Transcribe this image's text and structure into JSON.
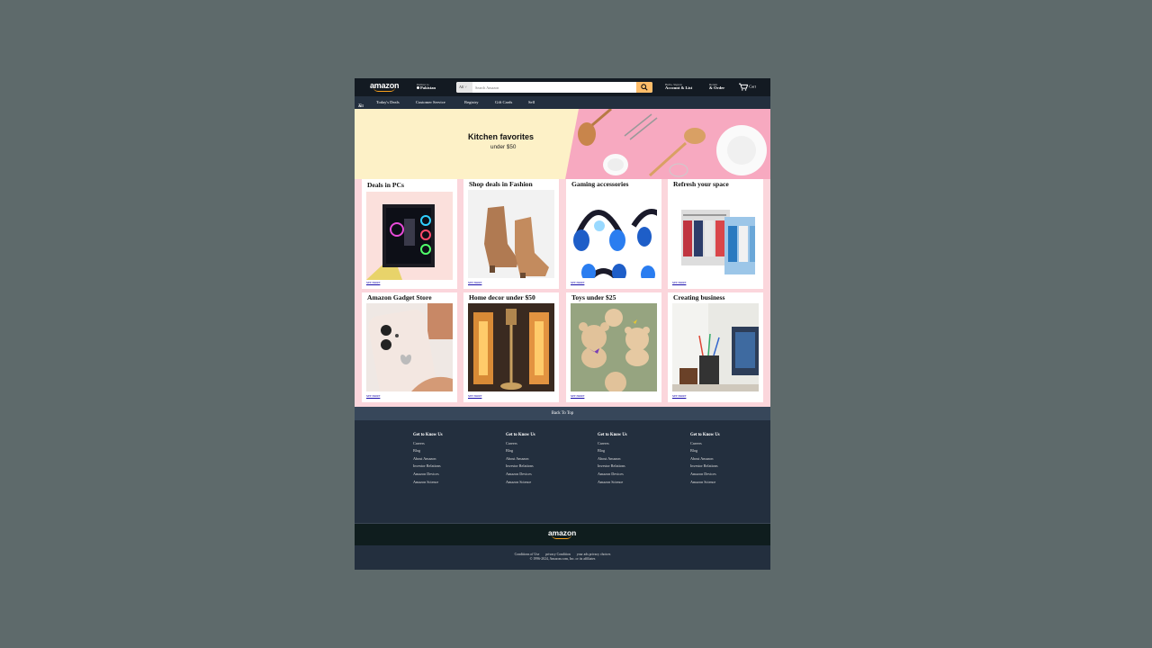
{
  "header": {
    "logo": "amazon",
    "deliver_line1": "Deliver to",
    "deliver_line2": "Pakistan",
    "search_category": "All",
    "search_placeholder": "Search Amazon",
    "account_line1": "Hello, Sign in",
    "account_line2": "Account & List",
    "returns_line1": "Return",
    "returns_line2": "& Order",
    "cart_label": "Cart"
  },
  "subnav": {
    "all_label": "All",
    "items": [
      "Today's Deals",
      "Customer Service",
      "Registry",
      "Gift Cards",
      "Sell"
    ]
  },
  "hero": {
    "title": "Kitchen favorites",
    "subtitle": "under $50"
  },
  "cards": [
    {
      "title": "Deals in PCs",
      "link": "see more"
    },
    {
      "title": "Shop deals in Fashion",
      "link": "see more"
    },
    {
      "title": "Gaming accessories",
      "link": "see more"
    },
    {
      "title": "Refresh your space",
      "link": "see more"
    },
    {
      "title": "Amazon Gadget Store",
      "link": "see more"
    },
    {
      "title": "Home decor under $50",
      "link": "see more"
    },
    {
      "title": "Toys under $25",
      "link": "see more"
    },
    {
      "title": "Creating business",
      "link": "see more"
    }
  ],
  "back_to_top": "Back To Top",
  "footer": {
    "columns": [
      {
        "heading": "Get to Know Us",
        "links": [
          "Careers",
          "Blog",
          "About Amazon",
          "Investor Relations",
          "Amazon Devices",
          "Amazon Science"
        ]
      },
      {
        "heading": "Get to Know Us",
        "links": [
          "Careers",
          "Blog",
          "About Amazon",
          "Investor Relations",
          "Amazon Devices",
          "Amazon Science"
        ]
      },
      {
        "heading": "Get to Know Us",
        "links": [
          "Careers",
          "Blog",
          "About Amazon",
          "Investor Relations",
          "Amazon Devices",
          "Amazon Science"
        ]
      },
      {
        "heading": "Get to Know Us",
        "links": [
          "Careers",
          "Blog",
          "About Amazon",
          "Investor Relations",
          "Amazon Devices",
          "Amazon Science"
        ]
      }
    ],
    "logo": "amazon",
    "bottom_links": [
      "Conditions of Use",
      "privacy Condition",
      "your ads privacy choices"
    ],
    "copyright": "© 1996-2024, Amazon.com, Inc. or its affiliates"
  },
  "colors": {
    "nav_bg": "#131a22",
    "subnav_bg": "#232f3e",
    "search_button": "#febd69",
    "accent_smile": "#f7a01c",
    "grid_bg": "#fbd6dc",
    "link": "#1a0dab"
  },
  "icons": [
    "location-pin-icon",
    "search-icon",
    "cart-icon",
    "menu-icon"
  ]
}
